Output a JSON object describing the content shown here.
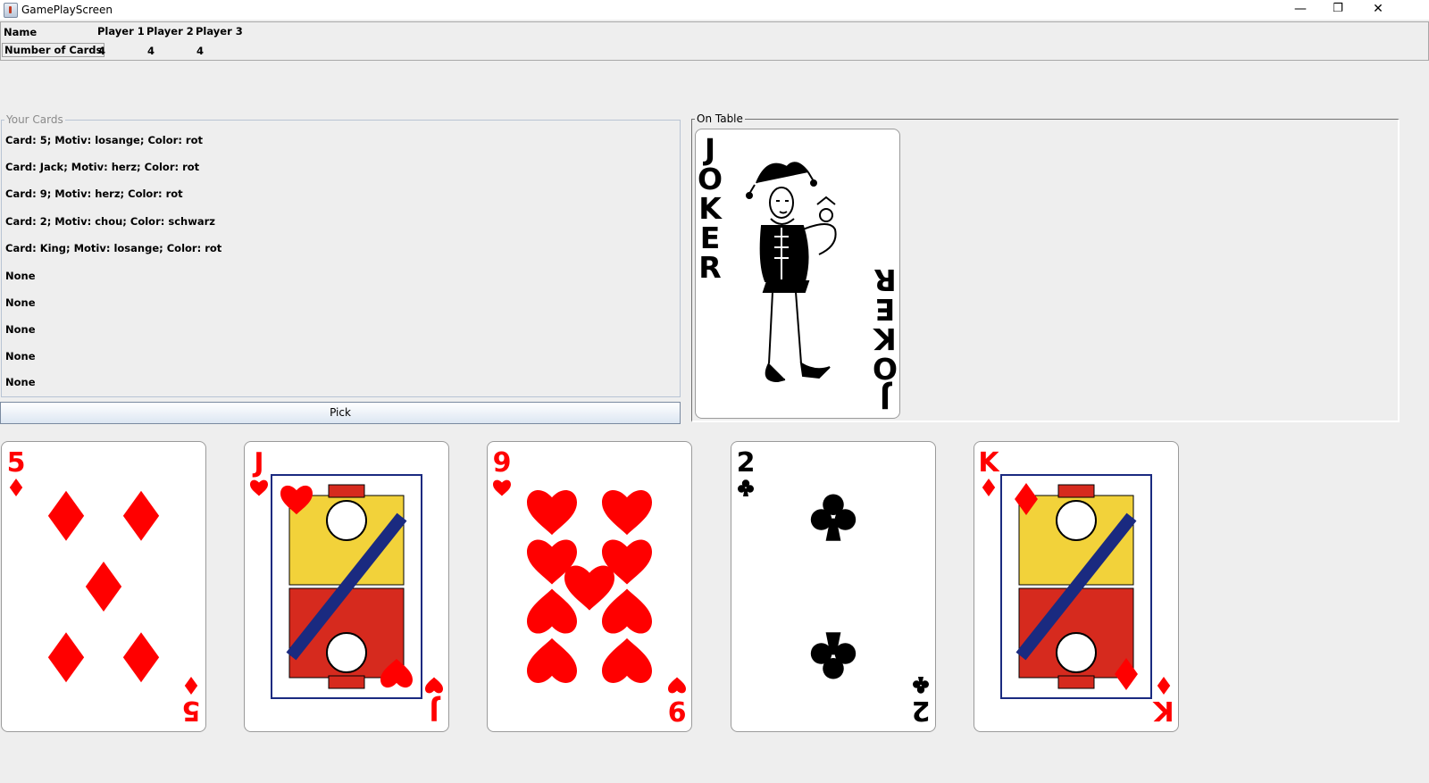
{
  "window": {
    "title": "GamePlayScreen",
    "minimize": "—",
    "restore": "❐",
    "close": "✕"
  },
  "players": {
    "name_label": "Name",
    "count_label": "Number of Cards",
    "list": [
      {
        "name": "Player 1",
        "cards": "4"
      },
      {
        "name": "Player 2",
        "cards": "4"
      },
      {
        "name": "Player 3",
        "cards": "4"
      }
    ]
  },
  "your_cards": {
    "title": "Your Cards",
    "items": [
      "Card: 5; Motiv: losange; Color: rot",
      "Card: Jack; Motiv: herz; Color: rot",
      "Card: 9; Motiv: herz; Color: rot",
      "Card: 2; Motiv: chou; Color: schwarz",
      "Card: King; Motiv: losange; Color: rot",
      "None",
      "None",
      "None",
      "None",
      "None"
    ]
  },
  "pick_button": "Pick",
  "on_table": {
    "title": "On Table",
    "card": {
      "rank": "JOKER",
      "color": "#000000"
    }
  },
  "hand": [
    {
      "rank": "5",
      "suit": "diamond",
      "color": "#ff0000"
    },
    {
      "rank": "J",
      "suit": "heart",
      "color": "#ff0000"
    },
    {
      "rank": "9",
      "suit": "heart",
      "color": "#ff0000"
    },
    {
      "rank": "2",
      "suit": "club",
      "color": "#000000"
    },
    {
      "rank": "K",
      "suit": "diamond",
      "color": "#ff0000"
    }
  ]
}
